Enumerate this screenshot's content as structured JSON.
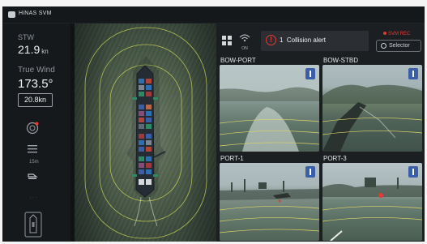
{
  "app": {
    "title": "HiNAS SVM"
  },
  "left_panel": {
    "stw_label": "STW",
    "stw_value": "21.9",
    "stw_unit": "kn",
    "wind_label": "True Wind",
    "wind_dir": "173.5°",
    "wind_speed": "20.8kn",
    "range_label": "15m"
  },
  "toolbar": {
    "wifi_label": "ON",
    "alert_count": "1",
    "alert_text": "Collision alert",
    "rec_label": "SVM REC",
    "selector_label": "Selector"
  },
  "cameras": [
    {
      "label": "BOW-PORT"
    },
    {
      "label": "BOW-STBD"
    },
    {
      "label": "PORT-1"
    },
    {
      "label": "PORT-3"
    }
  ],
  "colors": {
    "alert": "#e53935",
    "accent": "#3b5ea8"
  },
  "icons": [
    "app-logo-icon",
    "compass-icon",
    "range-icon",
    "ship-icon",
    "layout-grid-icon",
    "wifi-icon",
    "alert-icon",
    "record-icon",
    "selector-icon",
    "camera-badge-icon"
  ]
}
